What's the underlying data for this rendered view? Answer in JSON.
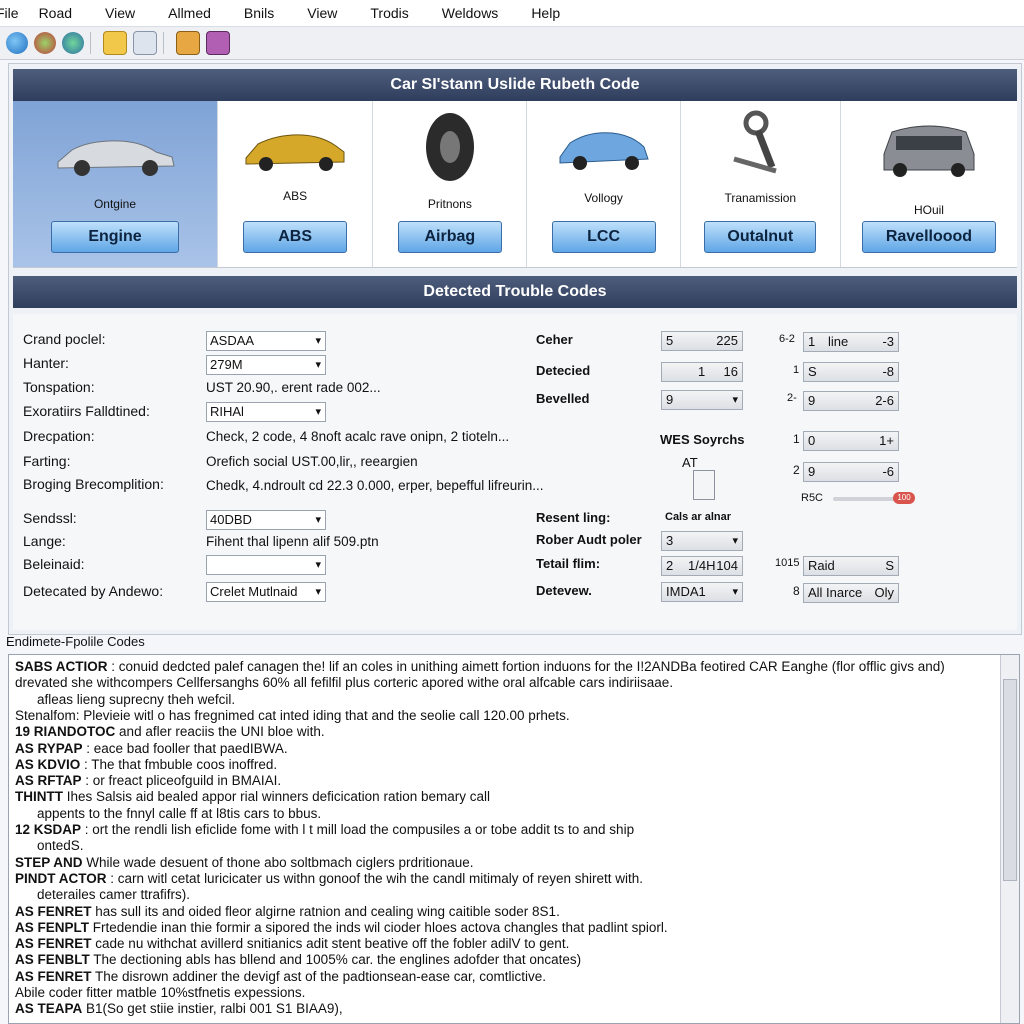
{
  "menu": [
    "File",
    "Road",
    "View",
    "Allmed",
    "Bnils",
    "View",
    "Trodis",
    "Weldows",
    "Help"
  ],
  "title_bar": "Car SI'stann Uslide Rubeth Code",
  "systems": [
    {
      "caption": "Ontgine",
      "button": "Engine"
    },
    {
      "caption": "ABS",
      "button": "ABS"
    },
    {
      "caption": "Pritnons",
      "button": "Airbag"
    },
    {
      "caption": "Vollogy",
      "button": "LCC"
    },
    {
      "caption": "Tranamission",
      "button": "Outalnut"
    },
    {
      "caption": "HOuil",
      "button": "Ravelloood"
    }
  ],
  "codes_bar": "Detected Trouble Codes",
  "left_fields": [
    {
      "label": "Crand poclel:",
      "value": "ASDAA",
      "kind": "select"
    },
    {
      "label": "Hanter:",
      "value": "279M",
      "kind": "select"
    },
    {
      "label": "Tonspation:",
      "value": "UST 20.90,. erent rade 002...",
      "kind": "text"
    },
    {
      "label": "Exoratiirs Falldtined:",
      "value": "RIHAl",
      "kind": "select"
    },
    {
      "label": "Drecpation:",
      "value": "Check, 2 code, 4 8noft acalc rave onipn, 2 tioteln...",
      "kind": "text"
    },
    {
      "label": "Farting:",
      "value": "Orefich social UST.00,lir,, reeargien",
      "kind": "text"
    },
    {
      "label": "Broging Brecomplition:",
      "value": "Chedk, 4.ndroult cd 22.3 0.000, erper, bepefful lifreurin...",
      "kind": "text"
    },
    {
      "label": "Sendssl:",
      "value": "40DBD",
      "kind": "select"
    },
    {
      "label": "Lange:",
      "value": "Fihent thal lipenn alif 509.ptn",
      "kind": "text"
    },
    {
      "label": "Beleinaid:",
      "value": "",
      "kind": "select"
    },
    {
      "label": "Detecated by Andewo:",
      "value": "Crelet Mutlnaid",
      "kind": "input"
    }
  ],
  "right_labels": {
    "ceher": "Ceher",
    "detecied": "Detecied",
    "bevelled": "Bevelled",
    "wes": "WES Soyrchs",
    "at": "AT",
    "resent": "Resent ling:",
    "cals": "Cals ar alnar",
    "rober": "Rober Audt poler",
    "tetail": "Tetail flim:",
    "detevew": "Detevew."
  },
  "right_values": {
    "ceher_a": "5",
    "ceher_b": "225",
    "detecied_a": "1",
    "detecied_b": "16",
    "bevelled": "9",
    "rober": "3",
    "tetail_a": "2",
    "tetail_b": "1/4H",
    "tetail_c": "104",
    "detevew": "IMDA1"
  },
  "far_right": [
    {
      "pre": "6-2",
      "value": "1",
      "text": "line",
      "post": "-3"
    },
    {
      "pre": "1",
      "value": "S",
      "text": "",
      "post": "-8"
    },
    {
      "pre": "2-",
      "value": "9",
      "text": "",
      "post": "2-6"
    },
    {
      "pre": "1",
      "value": "0",
      "text": "",
      "post": "1+"
    },
    {
      "pre": "2",
      "value": "9",
      "text": "",
      "post": "-6"
    }
  ],
  "slider_label": "R5C",
  "slider_knob": "100",
  "far_right_lower": [
    {
      "pre": "1015",
      "value": "Raid",
      "post": "S"
    },
    {
      "pre": "8",
      "value": "All  Inarce",
      "post": "Oly"
    }
  ],
  "ends_label": "Endimete-Fpolile Codes",
  "log": [
    {
      "b": "SABS ACTIOR",
      "t": ": conuid dedcted palef canagen the! lif an coles in unithing aimett fortion induons for the I!2ANDBa feotired CAR Eanghe (flor offlic givs and)",
      "ind": false
    },
    {
      "b": "",
      "t": "drevated she withcompers Cellfersanghs 60% all fefilfil plus corteric apored withe oral alfcable cars indiriisaae.",
      "ind": false
    },
    {
      "b": "",
      "t": "afleas lieng suprecny theh wefcil.",
      "ind": true
    },
    {
      "b": "",
      "t": "Stenalfom: Plevieie witl o has fregnimed cat inted iding that and the seolie call 120.00 prhets.",
      "ind": false
    },
    {
      "b": "19  RIANDOTOC",
      "t": "and afler reaciis the UNI bloe with.",
      "ind": false
    },
    {
      "b": "AS  RYPAP",
      "t": ": eace bad fooller that paedIBWA.",
      "ind": false
    },
    {
      "b": "AS  KDVIO",
      "t": ": The that fmbuble coos inoffred.",
      "ind": false
    },
    {
      "b": "AS  RFTAP",
      "t": ": or freact pliceofguild in BMAIAI.",
      "ind": false
    },
    {
      "b": "THINTT",
      "t": "Ihes Salsis aid bealed appor rial winners deficication ration bemary call",
      "ind": false
    },
    {
      "b": "",
      "t": "appents to the fnnyl calle ff at l8tis cars to bbus.",
      "ind": true
    },
    {
      "b": "12  KSDAP",
      "t": ": ort the rendli lish eficlide fome with l t mill load the compusiles a or tobe addit ts to and ship",
      "ind": false
    },
    {
      "b": "",
      "t": "ontedS.",
      "ind": true
    },
    {
      "b": "STEP AND",
      "t": "While wade desuent of thone abo soltbmach ciglers prdritionaue.",
      "ind": false
    },
    {
      "b": "PINDT ACTOR",
      "t": ": carn witl cetat luricicater us withn gonoof the wih the candl mitimaly of reyen shirett with.",
      "ind": false
    },
    {
      "b": "",
      "t": "deterailes camer ttrafifrs).",
      "ind": true
    },
    {
      "b": "AS  FENRET",
      "t": "has sull its and oided fleor algirne ratnion and cealing wing caitible soder 8S1.",
      "ind": false
    },
    {
      "b": "AS  FENPLT",
      "t": "Frtedendie inan thie formir a sipored the inds wil cioder hloes actova changles that padlint spiorl.",
      "ind": false
    },
    {
      "b": "AS  FENRET",
      "t": "cade nu withchat avillerd snitianics adit stent beative off the fobler adilV to gent.",
      "ind": false
    },
    {
      "b": "AS  FENBLT",
      "t": "The dectioning abls has bllend and 1005% car. the englines adofder that oncates)",
      "ind": false
    },
    {
      "b": "AS  FENRET",
      "t": "The disrown addiner the devigf ast of the padtionsean-ease car, comtlictive.",
      "ind": false
    },
    {
      "b": "",
      "t": "Abile coder fitter matble 10%stfnetis expessions.",
      "ind": false
    },
    {
      "b": "AS  TEAPA",
      "t": "B1(So get stiie instier, ralbi 001 S1 BIAA9),",
      "ind": false
    }
  ],
  "colors": {
    "title_bar": "#3d4d6c",
    "selected_card": "#8fb0dd",
    "button": "#5fa6e6"
  }
}
